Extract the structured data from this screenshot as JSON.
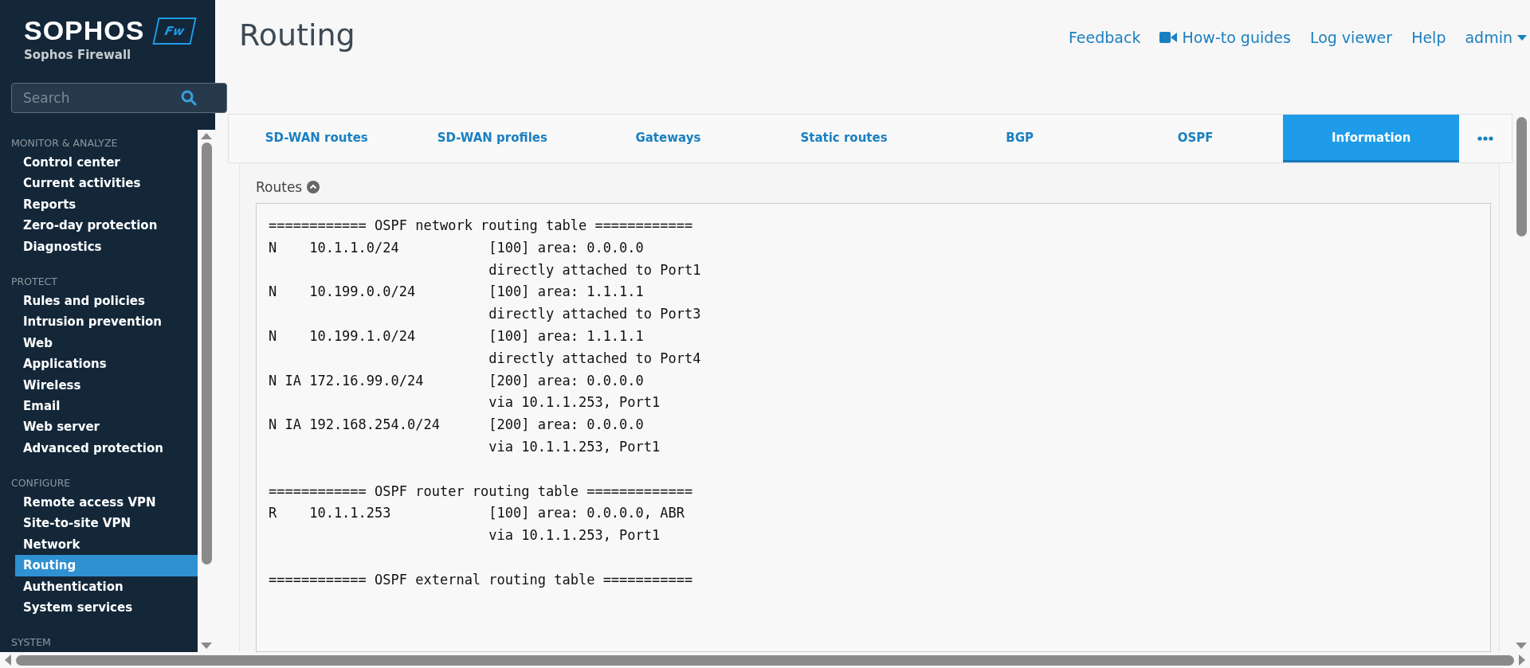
{
  "brand": {
    "logo": "SOPHOS",
    "badge": "Fw",
    "product": "Sophos Firewall"
  },
  "search": {
    "placeholder": "Search"
  },
  "sidebar": {
    "sections": [
      {
        "heading": "MONITOR & ANALYZE",
        "items": [
          {
            "label": "Control center",
            "selected": false
          },
          {
            "label": "Current activities",
            "selected": false
          },
          {
            "label": "Reports",
            "selected": false
          },
          {
            "label": "Zero-day protection",
            "selected": false
          },
          {
            "label": "Diagnostics",
            "selected": false
          }
        ]
      },
      {
        "heading": "PROTECT",
        "items": [
          {
            "label": "Rules and policies",
            "selected": false
          },
          {
            "label": "Intrusion prevention",
            "selected": false
          },
          {
            "label": "Web",
            "selected": false
          },
          {
            "label": "Applications",
            "selected": false
          },
          {
            "label": "Wireless",
            "selected": false
          },
          {
            "label": "Email",
            "selected": false
          },
          {
            "label": "Web server",
            "selected": false
          },
          {
            "label": "Advanced protection",
            "selected": false
          }
        ]
      },
      {
        "heading": "CONFIGURE",
        "items": [
          {
            "label": "Remote access VPN",
            "selected": false
          },
          {
            "label": "Site-to-site VPN",
            "selected": false
          },
          {
            "label": "Network",
            "selected": false
          },
          {
            "label": "Routing",
            "selected": true
          },
          {
            "label": "Authentication",
            "selected": false
          },
          {
            "label": "System services",
            "selected": false
          }
        ]
      },
      {
        "heading": "SYSTEM"
      }
    ]
  },
  "page": {
    "title": "Routing"
  },
  "header_links": [
    {
      "label": "Feedback",
      "kind": "link"
    },
    {
      "label": "How-to guides",
      "kind": "video"
    },
    {
      "label": "Log viewer",
      "kind": "link"
    },
    {
      "label": "Help",
      "kind": "link"
    },
    {
      "label": "admin",
      "kind": "menu"
    }
  ],
  "tabs": [
    {
      "label": "SD-WAN routes",
      "selected": false
    },
    {
      "label": "SD-WAN profiles",
      "selected": false
    },
    {
      "label": "Gateways",
      "selected": false
    },
    {
      "label": "Static routes",
      "selected": false
    },
    {
      "label": "BGP",
      "selected": false
    },
    {
      "label": "OSPF",
      "selected": false
    },
    {
      "label": "Information",
      "selected": true
    }
  ],
  "routes": {
    "title": "Routes",
    "expanded": true,
    "sections": [
      {
        "header": "============ OSPF network routing table ============",
        "lines": [
          "N    10.1.1.0/24           [100] area: 0.0.0.0",
          "                           directly attached to Port1",
          "N    10.199.0.0/24         [100] area: 1.1.1.1",
          "                           directly attached to Port3",
          "N    10.199.1.0/24         [100] area: 1.1.1.1",
          "                           directly attached to Port4",
          "N IA 172.16.99.0/24        [200] area: 0.0.0.0",
          "                           via 10.1.1.253, Port1",
          "N IA 192.168.254.0/24      [200] area: 0.0.0.0",
          "                           via 10.1.1.253, Port1"
        ]
      },
      {
        "header": "============ OSPF router routing table =============",
        "lines": [
          "R    10.1.1.253            [100] area: 0.0.0.0, ABR",
          "                           via 10.1.1.253, Port1"
        ]
      },
      {
        "header": "============ OSPF external routing table ==========="
      }
    ]
  }
}
